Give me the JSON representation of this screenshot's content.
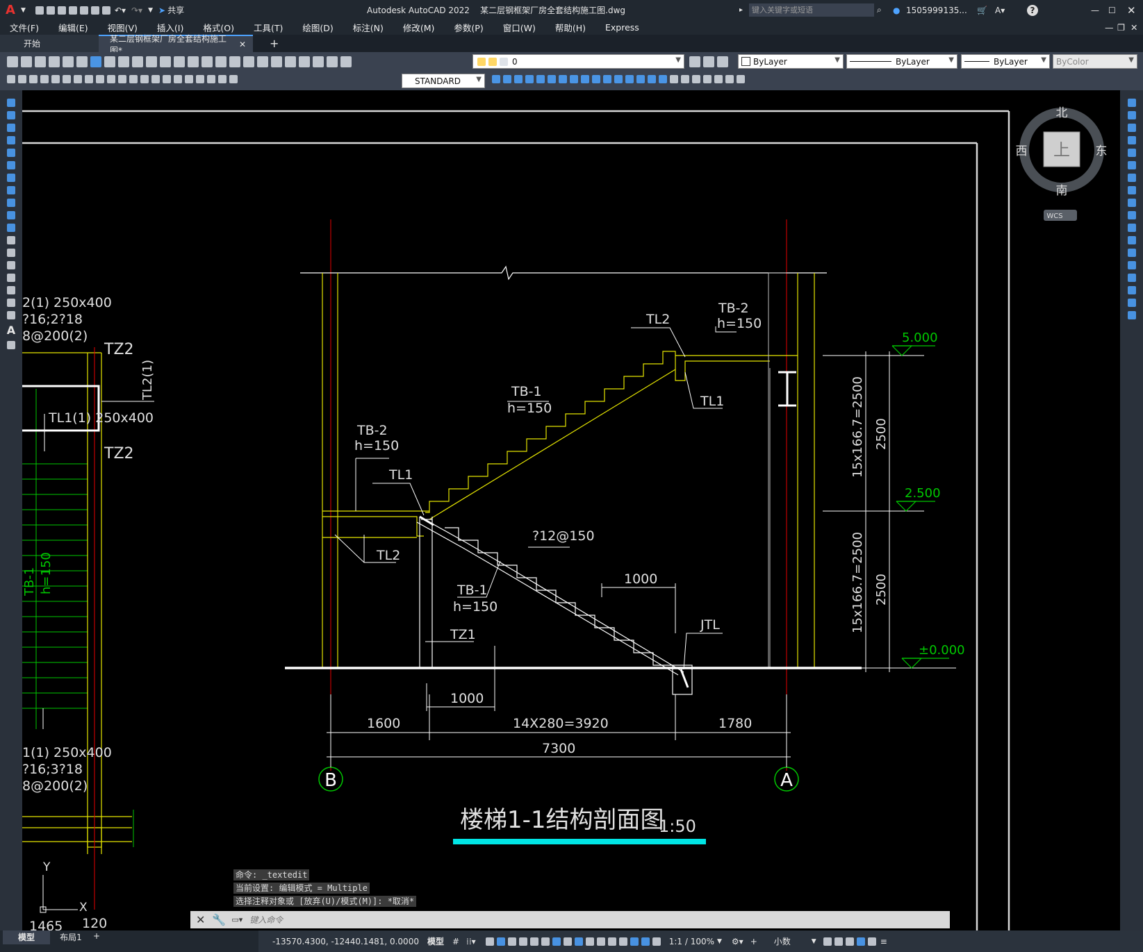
{
  "titlebar": {
    "app_logo": "A",
    "share": "共享",
    "title": "Autodesk AutoCAD 2022    某二层钢框架厂房全套结构施工图.dwg",
    "search_placeholder": "键入关键字或短语",
    "user": "1505999135...",
    "help": "?"
  },
  "menu": [
    "文件(F)",
    "编辑(E)",
    "视图(V)",
    "插入(I)",
    "格式(O)",
    "工具(T)",
    "绘图(D)",
    "标注(N)",
    "修改(M)",
    "参数(P)",
    "窗口(W)",
    "帮助(H)",
    "Express"
  ],
  "tabs": {
    "start": "开始",
    "active": "某二层钢框架厂房全套结构施工图*",
    "add": "+"
  },
  "toolbar": {
    "layer": "0",
    "color": "ByLayer",
    "linetype": "ByLayer",
    "lineweight": "ByLayer",
    "plotstyle": "ByColor",
    "textstyle": "STANDARD"
  },
  "viewcube": {
    "north": "北",
    "south": "南",
    "east": "东",
    "west": "西",
    "top": "上",
    "wcs": "WCS"
  },
  "drawing": {
    "title": "楼梯1-1结构剖面图",
    "scale": "1:50",
    "labels": {
      "tb2_top": "TB-2",
      "tb2_top_h": "h=150",
      "tl2_top": "TL2",
      "tl1_top": "TL1",
      "tb1_upper": "TB-1",
      "tb1_upper_h": "h=150",
      "tb2_left": "TB-2",
      "tb2_left_h": "h=150",
      "tl1_mid": "TL1",
      "tl2_mid": "TL2",
      "rebar": "?12@150",
      "tb1_lower": "TB-1",
      "tb1_lower_h": "h=150",
      "tz1": "TZ1",
      "jtl": "JTL",
      "dim_1000_a": "1000",
      "dim_1000_b": "1000",
      "dim_1600": "1600",
      "dim_3920": "14X280=3920",
      "dim_1780": "1780",
      "dim_7300": "7300",
      "axis_b": "B",
      "axis_a": "A",
      "elev_5000": "5.000",
      "elev_2500": "2.500",
      "elev_0": "±0.000",
      "vdim_upper": "15x166.7=2500",
      "vdim_lower": "15x166.7=2500",
      "vdim_2500_a": "2500",
      "vdim_2500_b": "2500"
    },
    "left_labels": {
      "l1": "2(1) 250x400",
      "l2": "?16;2?18",
      "l3": "8@200(2)",
      "tz2_a": "TZ2",
      "tl2_1": "TL2(1)",
      "tl1_1": "TL1(1) 250x400",
      "tz2_b": "TZ2",
      "tb1": "TB-1",
      "tb1_h": "h=150",
      "l4": "1(1) 250x400",
      "l5": "?16;3?18",
      "l6": "8@200(2)",
      "ucs_y": "Y",
      "ucs_x": "X",
      "n1465": "1465",
      "n120": "120"
    }
  },
  "commands": {
    "line1": "命令: _textedit",
    "line2": "当前设置: 编辑模式 = Multiple",
    "line3": "选择注释对象或 [放弃(U)/模式(M)]: *取消*",
    "placeholder": "键入命令"
  },
  "status": {
    "tab_model": "模型",
    "tab_layout": "布局1",
    "coords": "-13570.4300, -12440.1481, 0.0000",
    "space": "模型",
    "scale": "1:1 / 100%",
    "units": "小数"
  }
}
